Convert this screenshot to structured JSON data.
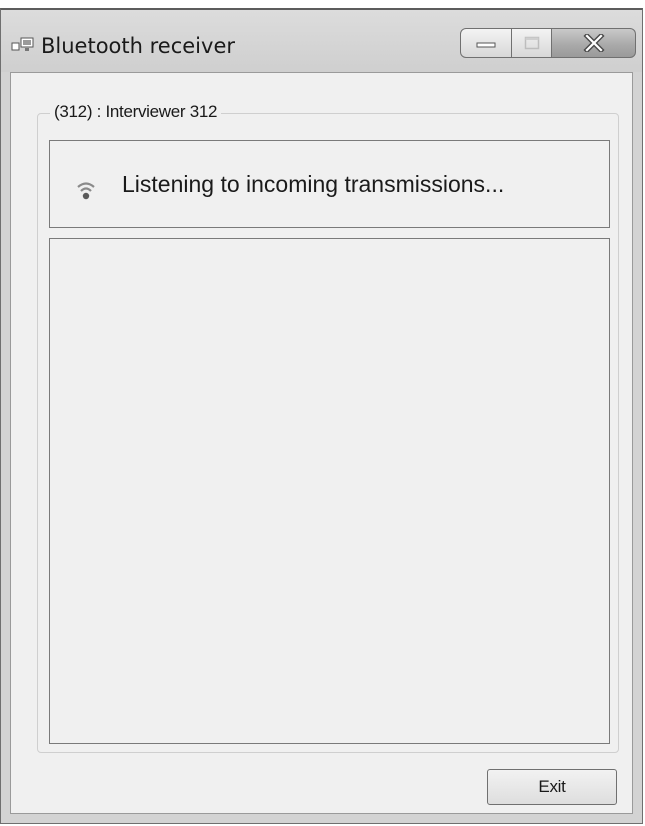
{
  "window": {
    "title": "Bluetooth receiver",
    "icon": "network-window-icon"
  },
  "caption_buttons": {
    "minimize_icon": "minimize-icon",
    "maximize_icon": "maximize-icon",
    "close_icon": "close-icon"
  },
  "group": {
    "label": "(312) : Interviewer 312"
  },
  "status": {
    "icon": "signal-icon",
    "text": "Listening to incoming transmissions..."
  },
  "log": {
    "entries": []
  },
  "footer": {
    "exit_label": "Exit"
  }
}
